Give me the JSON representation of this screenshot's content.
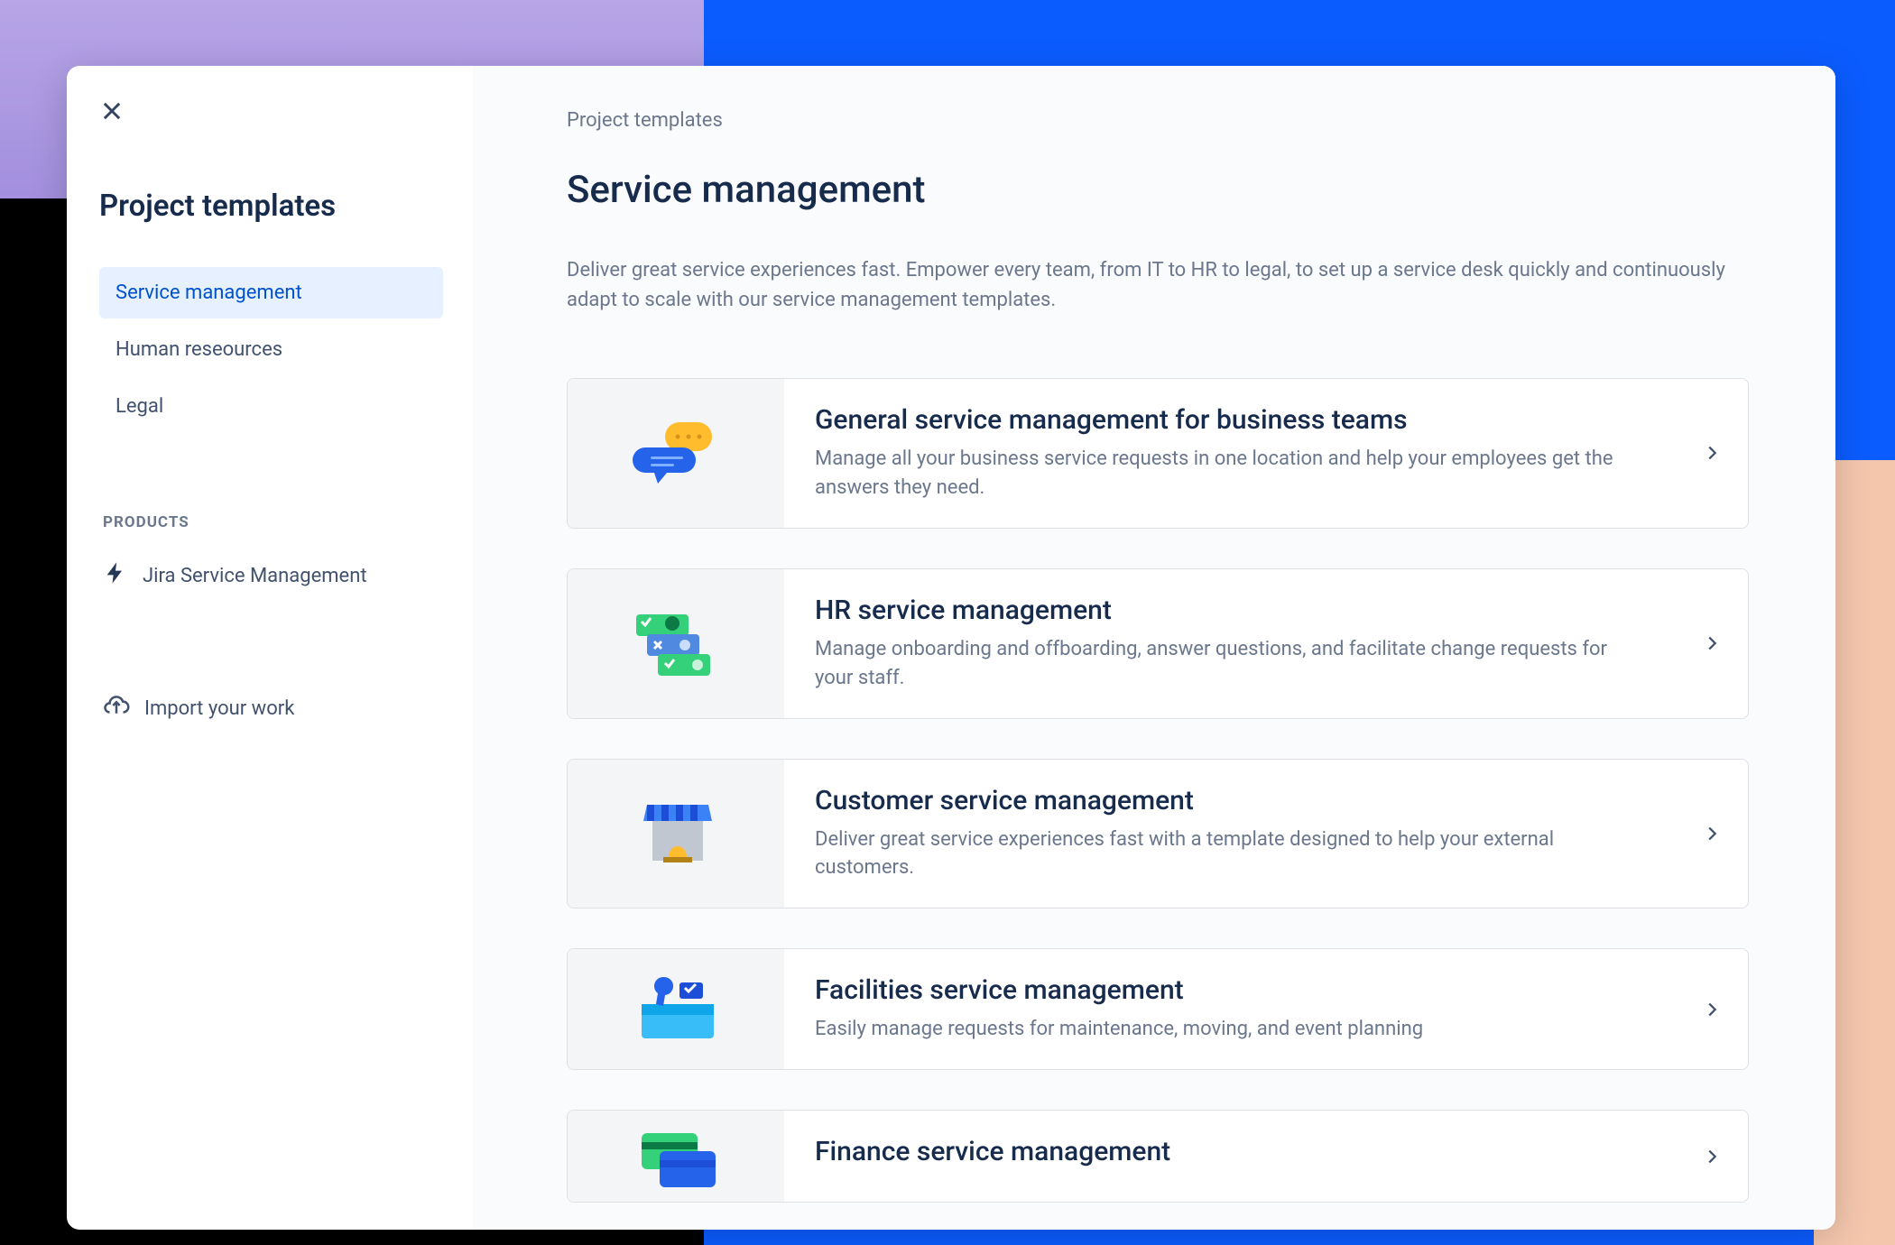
{
  "sidebar": {
    "title": "Project templates",
    "nav": [
      {
        "label": "Service management",
        "selected": true
      },
      {
        "label": "Human reseources",
        "selected": false
      },
      {
        "label": "Legal",
        "selected": false
      }
    ],
    "products_section_label": "PRODUCTS",
    "products": [
      {
        "label": "Jira Service Management",
        "icon": "bolt-icon"
      }
    ],
    "import_label": "Import your work"
  },
  "main": {
    "breadcrumb": "Project templates",
    "title": "Service management",
    "description": "Deliver great service experiences fast. Empower every team, from IT to HR to legal, to set up a service desk quickly and continuously adapt to scale with our service management templates.",
    "templates": [
      {
        "icon": "chat-bubbles-icon",
        "title": "General service management for business teams",
        "description": "Manage all your business service requests in one location and help your employees get the answers they need."
      },
      {
        "icon": "people-cards-icon",
        "title": "HR service management",
        "description": "Manage onboarding and offboarding, answer questions, and facilitate change requests for your staff."
      },
      {
        "icon": "storefront-icon",
        "title": "Customer service management",
        "description": "Deliver great service experiences fast with a template designed to help your external customers."
      },
      {
        "icon": "toolbox-icon",
        "title": "Facilities service management",
        "description": "Easily manage requests for maintenance, moving, and event planning"
      },
      {
        "icon": "credit-cards-icon",
        "title": "Finance service management",
        "description": ""
      }
    ]
  }
}
